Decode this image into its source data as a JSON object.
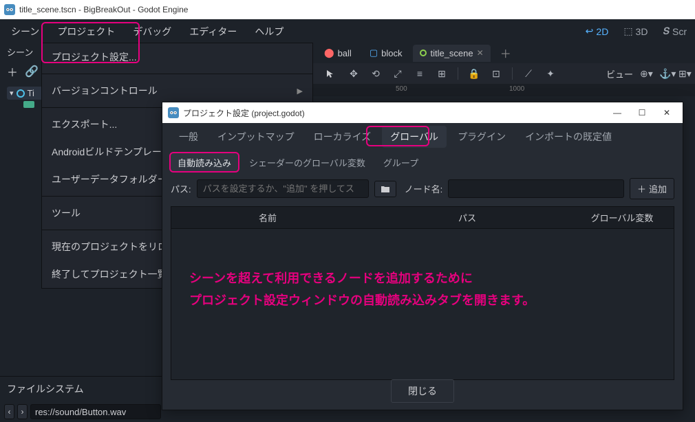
{
  "titlebar": {
    "text": "title_scene.tscn - BigBreakOut - Godot Engine"
  },
  "menubar": {
    "items": [
      "シーン",
      "プロジェクト",
      "デバッグ",
      "エディター",
      "ヘルプ"
    ],
    "mode_2d": "2D",
    "mode_3d": "3D",
    "mode_scr": "Scr"
  },
  "dropdown": {
    "project_settings": "プロジェクト設定...",
    "version_control": "バージョンコントロール",
    "export": "エクスポート...",
    "android_build": "Androidビルドテンプレー",
    "user_data_folder": "ユーザーデータフォルダー",
    "tools": "ツール",
    "reload_project": "現在のプロジェクトをリロ",
    "quit_to_list": "終了してプロジェクト一覧"
  },
  "scene_panel": {
    "tab": "シーン",
    "node_ti": "Ti"
  },
  "scene_tabs": {
    "ball": "ball",
    "block": "block",
    "title_scene": "title_scene"
  },
  "editor_toolbar": {
    "view": "ビュー"
  },
  "ruler": {
    "t500": "500",
    "t1000": "1000"
  },
  "dialog": {
    "title": "プロジェクト設定 (project.godot)",
    "tabs": {
      "general": "一般",
      "input_map": "インプットマップ",
      "localize": "ローカライズ",
      "global": "グローバル",
      "plugin": "プラグイン",
      "import_defaults": "インポートの既定値"
    },
    "subtabs": {
      "autoload": "自動読み込み",
      "shader_globals": "シェーダーのグローバル変数",
      "group": "グループ"
    },
    "path_label": "パス:",
    "path_placeholder": "パスを設定するか、\"追加\" を押してス",
    "node_label": "ノード名:",
    "add_button": "追加",
    "columns": {
      "name": "名前",
      "path": "パス",
      "global_var": "グローバル変数"
    },
    "annotation_line1": "シーンを超えて利用できるノードを追加するために",
    "annotation_line2": "プロジェクト設定ウィンドウの自動読み込みタブを開きます。",
    "close": "閉じる"
  },
  "filesystem": {
    "title": "ファイルシステム",
    "path": "res://sound/Button.wav"
  }
}
